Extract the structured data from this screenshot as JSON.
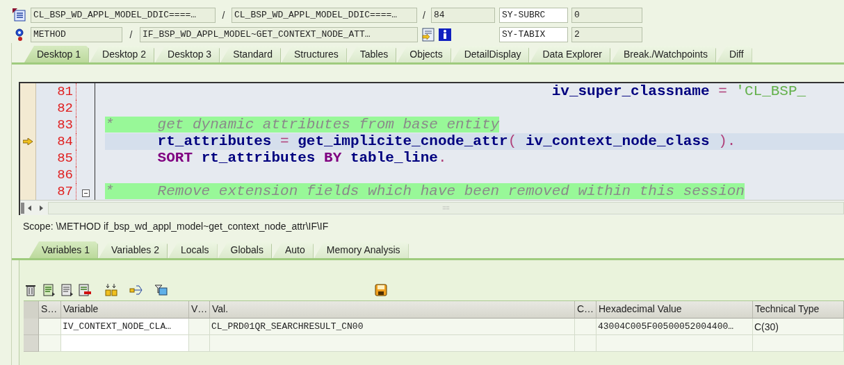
{
  "header": {
    "rows": [
      {
        "fields": [
          "CL_BSP_WD_APPL_MODEL_DDIC====…",
          "CL_BSP_WD_APPL_MODEL_DDIC====…",
          "84"
        ],
        "separators": [
          "/",
          "/"
        ],
        "sy_name": "SY-SUBRC",
        "sy_value": "0"
      },
      {
        "fields": [
          "METHOD",
          "IF_BSP_WD_APPL_MODEL~GET_CONTEXT_NODE_ATT…"
        ],
        "separators": [
          "/"
        ],
        "sy_name": "SY-TABIX",
        "sy_value": "2"
      }
    ]
  },
  "tabs": [
    {
      "label": "Desktop 1",
      "selected": true
    },
    {
      "label": "Desktop 2",
      "selected": false
    },
    {
      "label": "Desktop 3",
      "selected": false
    },
    {
      "label": "Standard",
      "selected": false
    },
    {
      "label": "Structures",
      "selected": false
    },
    {
      "label": "Tables",
      "selected": false
    },
    {
      "label": "Objects",
      "selected": false
    },
    {
      "label": "DetailDisplay",
      "selected": false
    },
    {
      "label": "Data Explorer",
      "selected": false
    },
    {
      "label": "Break./Watchpoints",
      "selected": false
    },
    {
      "label": "Diff",
      "selected": false
    }
  ],
  "code": {
    "lines": [
      {
        "number": "81",
        "current": false,
        "foldable": false,
        "tokens": [
          {
            "kind": "ident",
            "text": "                                                   iv_super_classname"
          },
          {
            "kind": "op",
            "text": " = "
          },
          {
            "kind": "string",
            "text": "'CL_BSP_"
          }
        ]
      },
      {
        "number": "82",
        "current": false,
        "foldable": false
      },
      {
        "number": "83",
        "current": false,
        "foldable": false,
        "tokens": [
          {
            "kind": "comment",
            "text": "*     get dynamic attributes from base entity"
          }
        ]
      },
      {
        "number": "84",
        "current": true,
        "foldable": false,
        "tokens": [
          {
            "kind": "ident",
            "text": "      rt_attributes"
          },
          {
            "kind": "op",
            "text": " = "
          },
          {
            "kind": "ident",
            "text": "get_implicite_cnode_attr"
          },
          {
            "kind": "op",
            "text": "( "
          },
          {
            "kind": "ident",
            "text": "iv_context_node_class"
          },
          {
            "kind": "op",
            "text": " )."
          }
        ]
      },
      {
        "number": "85",
        "current": false,
        "foldable": false,
        "tokens": [
          {
            "kind": "keyword",
            "text": "      SORT"
          },
          {
            "kind": "ident",
            "text": " rt_attributes "
          },
          {
            "kind": "keyword",
            "text": "BY"
          },
          {
            "kind": "ident",
            "text": " table_line"
          },
          {
            "kind": "op",
            "text": "."
          }
        ]
      },
      {
        "number": "86",
        "current": false,
        "foldable": false
      },
      {
        "number": "87",
        "current": false,
        "foldable": true,
        "tokens": [
          {
            "kind": "comment",
            "text": "*     Remove extension fields which have been removed within this session"
          }
        ]
      }
    ]
  },
  "scope": "Scope: \\METHOD if_bsp_wd_appl_model~get_context_node_attr\\IF\\IF",
  "variable_tabs": [
    {
      "label": "Variables 1",
      "selected": true
    },
    {
      "label": "Variables 2",
      "selected": false
    },
    {
      "label": "Locals",
      "selected": false
    },
    {
      "label": "Globals",
      "selected": false
    },
    {
      "label": "Auto",
      "selected": false
    },
    {
      "label": "Memory Analysis",
      "selected": false
    }
  ],
  "table": {
    "columns": [
      "S…",
      "Variable",
      "V…",
      "Val.",
      "C…",
      "Hexadecimal Value",
      "Technical Type"
    ],
    "rows": [
      {
        "cells": [
          null,
          "IV_CONTEXT_NODE_CLA…",
          null,
          "CL_PRD01QR_SEARCHRESULT_CN00",
          null,
          "43004C005F00500052004400…",
          "C(30)"
        ]
      }
    ]
  }
}
